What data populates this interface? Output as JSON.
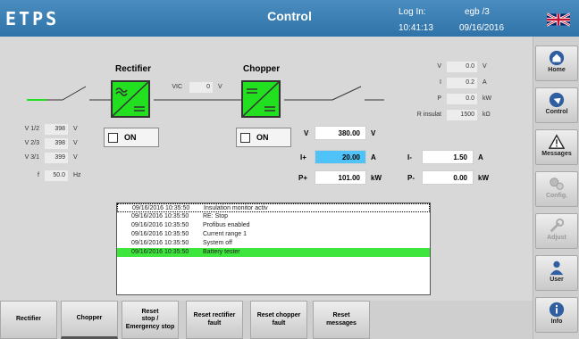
{
  "header": {
    "logo": "ETPS",
    "title": "Control",
    "login_label": "Log In:",
    "user": "egb /3",
    "time": "10:41:13",
    "date": "09/16/2016"
  },
  "diagram": {
    "rectifier_label": "Rectifier",
    "chopper_label": "Chopper",
    "vic_label": "VIC",
    "vic_value": "0",
    "vic_unit": "V",
    "rectifier_check": "ON",
    "chopper_check": "ON"
  },
  "left_meas": [
    {
      "label": "V 1/2",
      "value": "398",
      "unit": "V"
    },
    {
      "label": "V 2/3",
      "value": "398",
      "unit": "V"
    },
    {
      "label": "V 3/1",
      "value": "399",
      "unit": "V"
    },
    {
      "label": "f",
      "value": "50.0",
      "unit": "Hz"
    }
  ],
  "right_meas": [
    {
      "label": "V",
      "value": "0.0",
      "unit": "V"
    },
    {
      "label": "I",
      "value": "0.2",
      "unit": "A"
    },
    {
      "label": "P",
      "value": "0.0",
      "unit": "kW"
    },
    {
      "label": "R insulat",
      "value": "1500",
      "unit": "kΩ"
    }
  ],
  "setpoints": {
    "v_label": "V",
    "v_value": "380.00",
    "v_unit": "V",
    "ip_label": "I+",
    "ip_value": "20.00",
    "ip_unit": "A",
    "im_label": "I-",
    "im_value": "1.50",
    "im_unit": "A",
    "pp_label": "P+",
    "pp_value": "101.00",
    "pp_unit": "kW",
    "pm_label": "P-",
    "pm_value": "0.00",
    "pm_unit": "kW"
  },
  "log": [
    {
      "date": "09/16/2016 10:35:50",
      "msg": "Insulation monitor activ"
    },
    {
      "date": "09/16/2016 10:35:50",
      "msg": "RE: Stop"
    },
    {
      "date": "09/16/2016 10:35:50",
      "msg": "Profibus enabled"
    },
    {
      "date": "09/16/2016 10:35:50",
      "msg": "Current range 1"
    },
    {
      "date": "09/16/2016 10:35:50",
      "msg": "System off"
    },
    {
      "date": "09/16/2016 10:35:50",
      "msg": "Battery tester"
    }
  ],
  "sidebar": [
    {
      "label": "Home",
      "icon": "home-icon"
    },
    {
      "label": "Control",
      "icon": "control-icon"
    },
    {
      "label": "Messages",
      "icon": "warning-icon"
    },
    {
      "label": "Config.",
      "icon": "gears-icon"
    },
    {
      "label": "Adjust",
      "icon": "wrench-icon"
    },
    {
      "label": "User",
      "icon": "user-icon"
    },
    {
      "label": "Info",
      "icon": "info-icon"
    }
  ],
  "bottom": [
    {
      "label": "Rectifier"
    },
    {
      "label": "Chopper"
    },
    {
      "label": "Reset\nstop /\nEmergency stop"
    },
    {
      "label": "Reset rectifier\nfault"
    },
    {
      "label": "Reset chopper\nfault"
    },
    {
      "label": "Reset\nmessages"
    }
  ],
  "colors": {
    "accent": "#2f73a8",
    "block_green": "#22e01f",
    "highlight_blue": "#4fc3f7"
  }
}
